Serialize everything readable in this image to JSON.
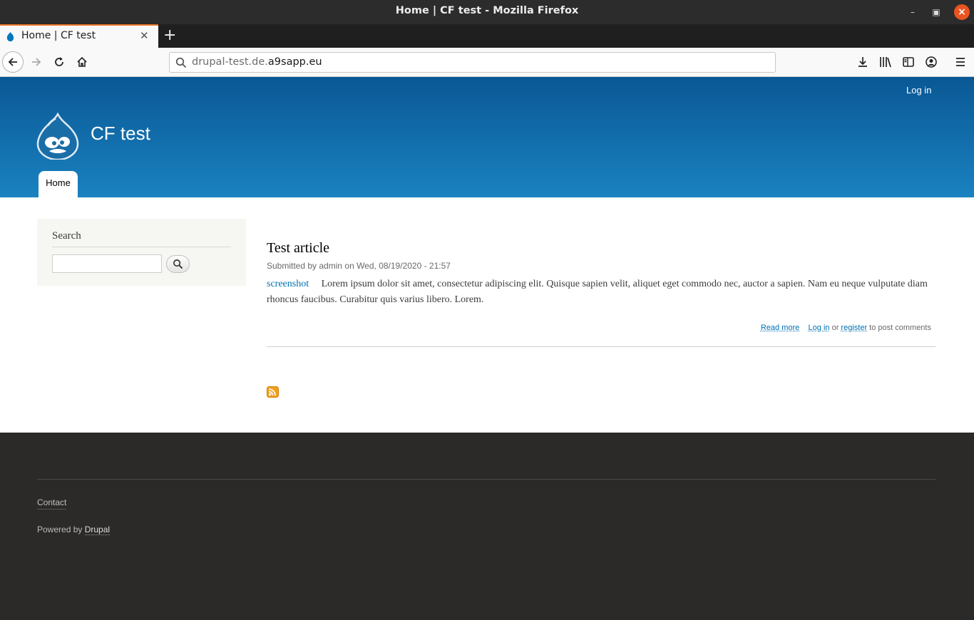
{
  "window": {
    "title": "Home | CF test - Mozilla Firefox"
  },
  "tab": {
    "label": "Home | CF test"
  },
  "urlbar": {
    "url_host_prefix": "drupal-test.de.",
    "url_host_main": "a9sapp.eu"
  },
  "header": {
    "login_label": "Log in",
    "site_name": "CF test",
    "nav": [
      {
        "label": "Home"
      }
    ]
  },
  "sidebar": {
    "search_title": "Search",
    "search_value": ""
  },
  "article": {
    "title": "Test article",
    "meta": "Submitted by admin on Wed, 08/19/2020 - 21:57",
    "image_link": "screenshot",
    "body": "Lorem ipsum dolor sit amet, consectetur adipiscing elit. Quisque sapien velit, aliquet eget commodo nec, auctor a sapien. Nam eu neque vulputate diam rhoncus faucibus. Curabitur quis varius libero. Lorem.",
    "read_more": "Read more",
    "login": "Log in",
    "or": "or",
    "register": "register",
    "post_comments": "to post comments"
  },
  "footer": {
    "contact": "Contact",
    "powered_by": "Powered by",
    "drupal": "Drupal"
  },
  "colors": {
    "accent": "#e9752a",
    "header_top": "#0a5895",
    "header_bottom": "#1a82c0",
    "link": "#0071b3",
    "rss": "#f29f1c"
  },
  "icons": [
    "window-minimize-icon",
    "window-maximize-icon",
    "window-close-icon",
    "drupal-favicon-icon",
    "tab-close-icon",
    "new-tab-icon",
    "back-icon",
    "forward-icon",
    "reload-icon",
    "home-icon",
    "search-icon",
    "downloads-icon",
    "library-icon",
    "sidebar-icon",
    "account-icon",
    "menu-icon",
    "drupal-logo-icon",
    "rss-feed-icon"
  ]
}
